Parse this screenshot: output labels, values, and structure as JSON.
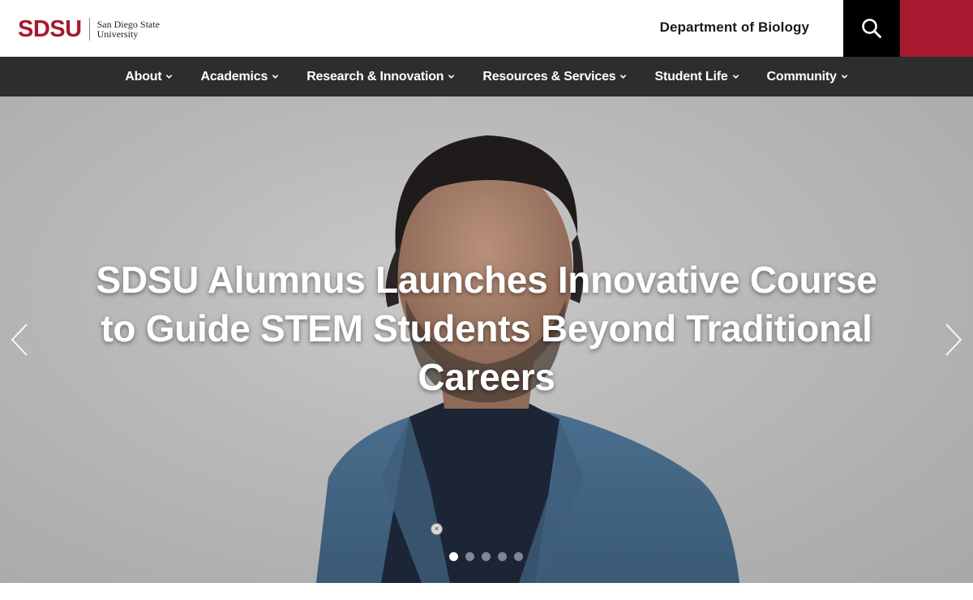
{
  "brand": {
    "logo_mark": "SDSU",
    "logo_line1": "San Diego State",
    "logo_line2": "University",
    "accent_color": "#a6192e"
  },
  "header": {
    "department": "Department of Biology",
    "search_icon": "search-icon"
  },
  "nav": {
    "items": [
      {
        "label": "About"
      },
      {
        "label": "Academics"
      },
      {
        "label": "Research & Innovation"
      },
      {
        "label": "Resources & Services"
      },
      {
        "label": "Student Life"
      },
      {
        "label": "Community"
      }
    ]
  },
  "hero": {
    "headline": "SDSU Alumnus Launches Innovative Course to Guide STEM Students Beyond Traditional Careers",
    "pause_glyph": "×",
    "slide_count": 5,
    "active_slide": 1
  }
}
